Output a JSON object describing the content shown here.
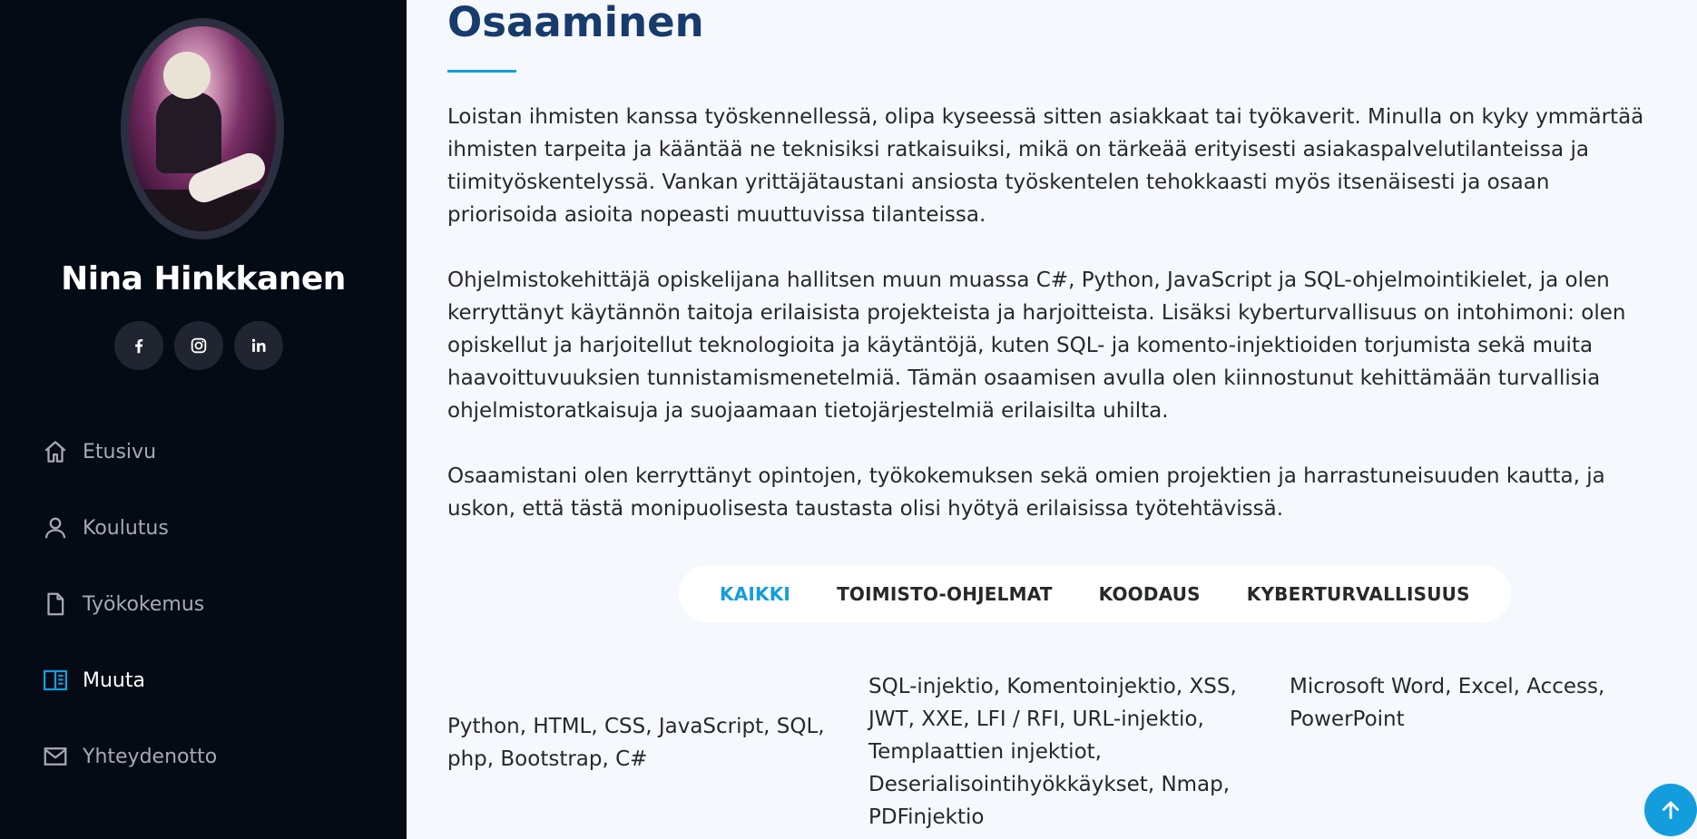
{
  "sidebar": {
    "name": "Nina Hinkkanen",
    "socials": [
      {
        "label": "f",
        "icon": "facebook-icon"
      },
      {
        "label": "instagram",
        "icon": "instagram-icon"
      },
      {
        "label": "in",
        "icon": "linkedin-icon"
      }
    ],
    "nav": [
      {
        "label": "Etusivu",
        "icon": "home-icon",
        "active": false
      },
      {
        "label": "Koulutus",
        "icon": "person-icon",
        "active": false
      },
      {
        "label": "Työkokemus",
        "icon": "file-icon",
        "active": false
      },
      {
        "label": "Muuta",
        "icon": "book-icon",
        "active": true
      },
      {
        "label": "Yhteydenotto",
        "icon": "envelope-icon",
        "active": false
      }
    ]
  },
  "main": {
    "title": "Osaaminen",
    "paragraphs": [
      "Loistan ihmisten kanssa työskennellessä, olipa kyseessä sitten asiakkaat tai työkaverit. Minulla on kyky ymmärtää ihmisten tarpeita ja kääntää ne teknisiksi ratkaisuiksi, mikä on tärkeää erityisesti asiakaspalvelutilanteissa ja tiimityöskentelyssä. Vankan yrittäjätaustani ansiosta työskentelen tehokkaasti myös itsenäisesti ja osaan priorisoida asioita nopeasti muuttuvissa tilanteissa.",
      "Ohjelmistokehittäjä opiskelijana hallitsen muun muassa C#, Python, JavaScript ja SQL-ohjelmointikielet, ja olen kerryttänyt käytännön taitoja erilaisista projekteista ja harjoitteista. Lisäksi kyberturvallisuus on intohimoni: olen opiskellut ja harjoitellut teknologioita ja käytäntöjä, kuten SQL- ja komento-injektioiden torjumista sekä muita haavoittuvuuksien tunnistamismenetelmiä. Tämän osaamisen avulla olen kiinnostunut kehittämään turvallisia ohjelmistoratkaisuja ja suojaamaan tietojärjestelmiä erilaisilta uhilta.",
      "Osaamistani olen kerryttänyt opintojen, työkokemuksen sekä omien projektien ja harrastuneisuuden kautta, ja uskon, että tästä monipuolisesta taustasta olisi hyötyä erilaisissa työtehtävissä."
    ],
    "filters": [
      {
        "label": "KAIKKI",
        "active": true
      },
      {
        "label": "TOIMISTO-OHJELMAT",
        "active": false
      },
      {
        "label": "KOODAUS",
        "active": false
      },
      {
        "label": "KYBERTURVALLISUUS",
        "active": false
      }
    ],
    "skills": {
      "coding": "Python, HTML, CSS, JavaScript, SQL, php, Bootstrap, C#",
      "cyber": "SQL-injektio, Komentoinjektio, XSS, JWT, XXE, LFI / RFI, URL-injektio, Templaattien injektiot, Deserialisointihyökkäykset, Nmap, PDFinjektio",
      "office": "Microsoft Word, Excel, Access, PowerPoint"
    }
  },
  "colors": {
    "sidebar_bg": "#040b14",
    "accent": "#149ddd",
    "title": "#173b6c",
    "main_bg": "#f5f8fd"
  }
}
